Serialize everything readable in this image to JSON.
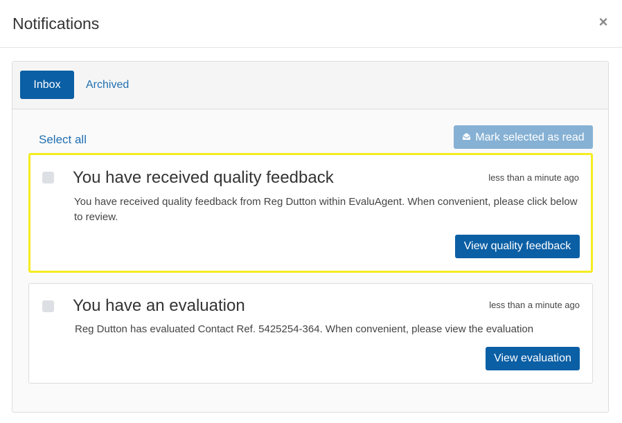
{
  "header": {
    "title": "Notifications",
    "close_label": "×"
  },
  "tabs": [
    {
      "label": "Inbox",
      "active": true
    },
    {
      "label": "Archived",
      "active": false
    }
  ],
  "toolbar": {
    "select_all_label": "Select all",
    "mark_read_label": "Mark selected as read",
    "mark_read_icon": "envelope-open-icon"
  },
  "notifications": [
    {
      "title": "You have received quality feedback",
      "time": "less than a minute ago",
      "body": "You have received quality feedback from Reg Dutton within EvaluAgent. When convenient, please click below to review.",
      "button_label": "View quality feedback",
      "highlighted": true
    },
    {
      "title": "You have an evaluation",
      "time": "less than a minute ago",
      "body": "Reg Dutton has evaluated Contact Ref. 5425254-364. When convenient, please view the evaluation",
      "button_label": "View evaluation",
      "highlighted": false
    }
  ],
  "colors": {
    "primary": "#0b5fa5",
    "primary_disabled": "#86b1d4",
    "link": "#1f6fb2",
    "highlight_border": "#f5ec1f"
  }
}
